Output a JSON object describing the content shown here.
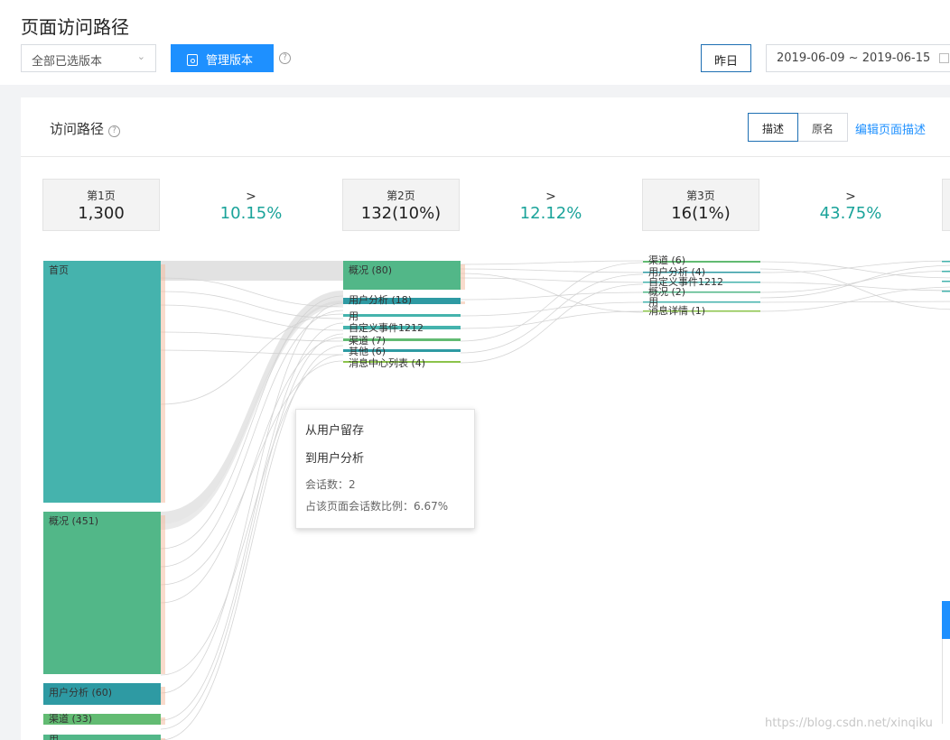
{
  "header": {
    "title": "页面访问路径",
    "version_select": "全部已选版本",
    "manage_button": "管理版本",
    "yesterday_button": "昨日",
    "date_range": "2019-06-09 ~ 2019-06-15"
  },
  "card": {
    "title": "访问路径",
    "seg_desc": "描述",
    "seg_orig": "原名",
    "edit_link": "编辑页面描述"
  },
  "steps": [
    {
      "label": "第1页",
      "value": "1,300"
    },
    {
      "label": "第2页",
      "value": "132(10%)"
    },
    {
      "label": "第3页",
      "value": "16(1%)"
    }
  ],
  "rates": [
    {
      "arrow": ">",
      "pct": "10.15%"
    },
    {
      "arrow": ">",
      "pct": "12.12%"
    },
    {
      "arrow": ">",
      "pct": "43.75%"
    }
  ],
  "columns": [
    {
      "nodes": [
        {
          "label": "首页",
          "color": "#45b3ad"
        },
        {
          "label": "概况 (451)",
          "color": "#52b788"
        },
        {
          "label": "用户分析 (60)",
          "color": "#2e9aa3"
        },
        {
          "label": "渠道 (33)",
          "color": "#62bb72"
        },
        {
          "label": "用",
          "color": "#52b788"
        }
      ]
    },
    {
      "nodes": [
        {
          "label": "概况 (80)",
          "color": "#52b788"
        },
        {
          "label": "用户分析 (18)",
          "color": "#2e9aa3"
        },
        {
          "label": "用",
          "color": "#45b3ad"
        },
        {
          "label": "自定义事件1212",
          "color": "#45b3ad"
        },
        {
          "label": "渠道 (7)",
          "color": "#62bb72"
        },
        {
          "label": "其他 (6)",
          "color": "#2e9aa3"
        },
        {
          "label": "消息中心列表 (4)",
          "color": "#8bc34a"
        }
      ]
    },
    {
      "nodes": [
        {
          "label": "渠道 (6)",
          "color": "#62bb72"
        },
        {
          "label": "用户分析 (4)",
          "color": "#2e9aa3"
        },
        {
          "label": "自定义事件1212",
          "color": "#45b3ad"
        },
        {
          "label": "概况 (2)",
          "color": "#52b788"
        },
        {
          "label": "用",
          "color": "#45b3ad"
        },
        {
          "label": "消息详情 (1)",
          "color": "#8bc34a"
        }
      ]
    }
  ],
  "tooltip": {
    "from": "从用户留存",
    "to": "到用户分析",
    "sessions": "会话数：2",
    "ratio": "占该页面会话数比例：6.67%"
  },
  "watermark": "https://blog.csdn.net/xinqiku"
}
